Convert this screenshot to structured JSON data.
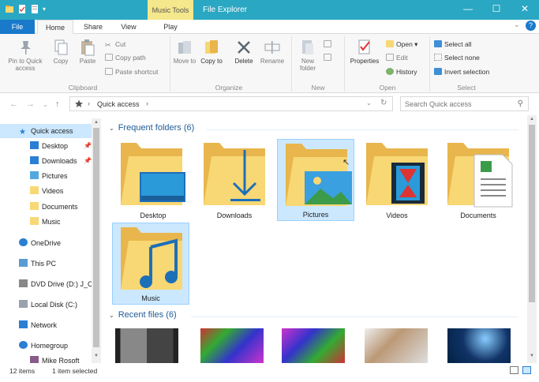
{
  "window": {
    "title": "File Explorer",
    "context_tab": "Music Tools",
    "minimize": "—",
    "maximize": "☐",
    "close": "✕",
    "help": "?"
  },
  "tabs": [
    {
      "label": "File"
    },
    {
      "label": "Home"
    },
    {
      "label": "Share"
    },
    {
      "label": "View"
    },
    {
      "label": "Play"
    }
  ],
  "ribbon": {
    "pin_label": "Pin to Quick access",
    "copy_label": "Copy",
    "paste_label": "Paste",
    "cut_label": "Cut",
    "copy_path_label": "Copy path",
    "paste_shortcut_label": "Paste shortcut",
    "clipboard_group": "Clipboard",
    "move_to_label": "Move to",
    "copy_to_label": "Copy to",
    "delete_label": "Delete",
    "rename_label": "Rename",
    "organize_group": "Organize",
    "new_folder_label": "New folder",
    "new_group": "New",
    "properties_label": "Properties",
    "open_label": "Open",
    "edit_label": "Edit",
    "history_label": "History",
    "open_group": "Open",
    "select_all_label": "Select all",
    "select_none_label": "Select none",
    "invert_selection_label": "Invert selection",
    "select_group": "Select"
  },
  "address": {
    "path": "Quick access",
    "search_placeholder": "Search Quick access"
  },
  "nav": {
    "items": [
      {
        "label": "Quick access"
      },
      {
        "label": "Desktop"
      },
      {
        "label": "Downloads"
      },
      {
        "label": "Pictures"
      },
      {
        "label": "Videos"
      },
      {
        "label": "Documents"
      },
      {
        "label": "Music"
      },
      {
        "label": "OneDrive"
      },
      {
        "label": "This PC"
      },
      {
        "label": "DVD Drive (D:) J_C"
      },
      {
        "label": "Local Disk (C:)"
      },
      {
        "label": "Network"
      },
      {
        "label": "Homegroup"
      },
      {
        "label": "Mike Rosoft"
      }
    ]
  },
  "content": {
    "frequent_header": "Frequent folders (6)",
    "recent_header": "Recent files (6)",
    "folders": [
      {
        "label": "Desktop"
      },
      {
        "label": "Downloads"
      },
      {
        "label": "Pictures"
      },
      {
        "label": "Videos"
      },
      {
        "label": "Documents"
      },
      {
        "label": "Music"
      }
    ]
  },
  "status": {
    "items": "12 items",
    "selected": "1 item selected"
  },
  "colors": {
    "titlebar": "#2aa7c2",
    "file_tab": "#1979ca",
    "selection": "#cce8ff",
    "folder": "#f8d775",
    "context_tab": "#f5e78b",
    "section_header": "#1e5b96"
  }
}
